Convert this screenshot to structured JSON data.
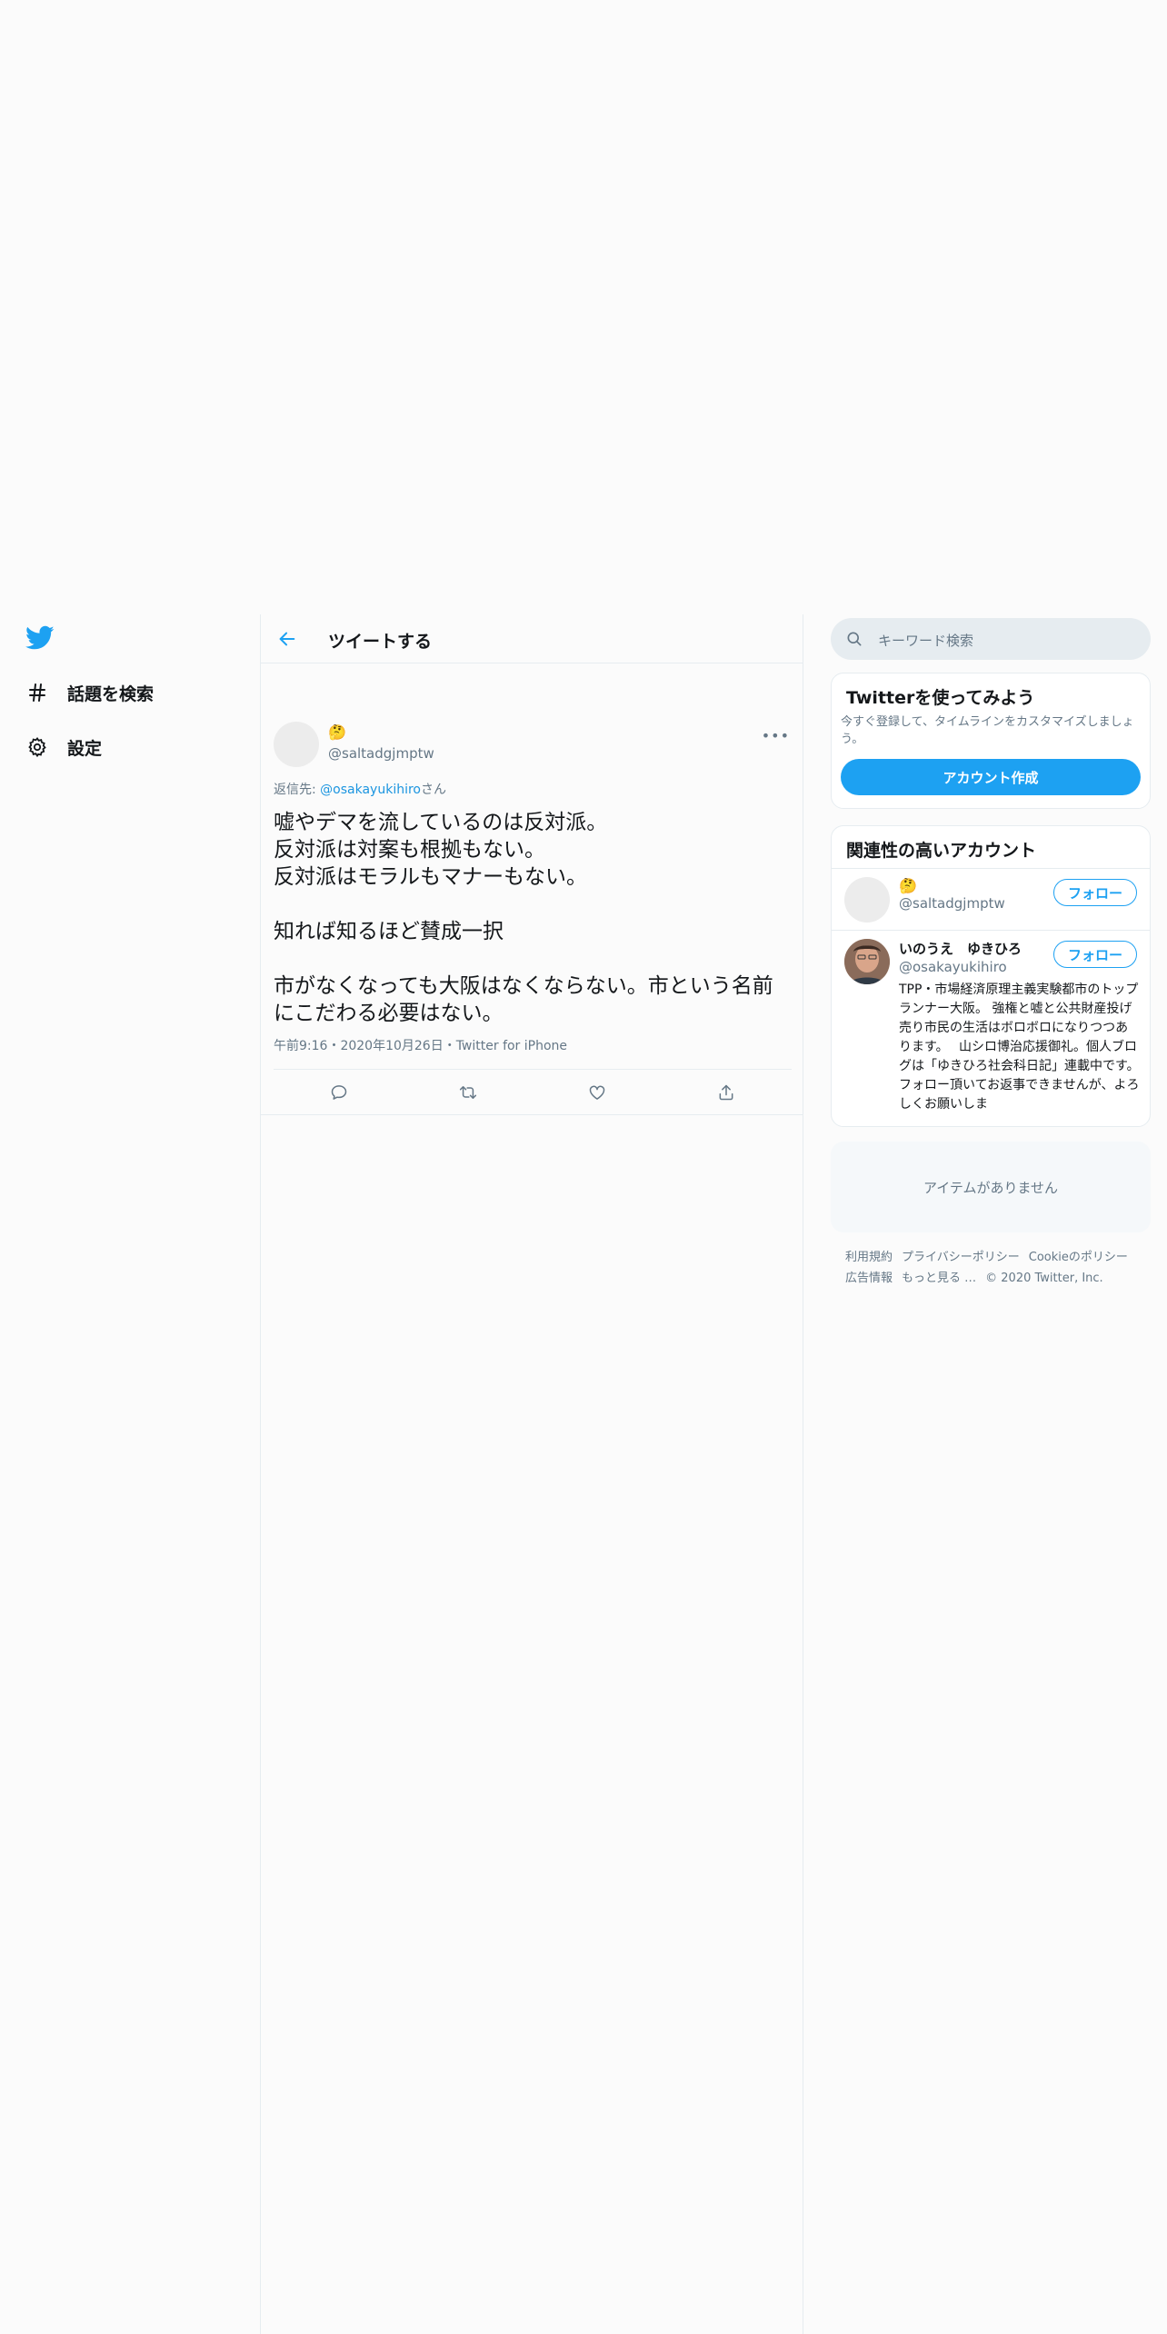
{
  "nav": {
    "explore_label": "話題を検索",
    "settings_label": "設定"
  },
  "header": {
    "title": "ツイートする"
  },
  "tweet": {
    "author_emoji": "🤔",
    "author_handle": "@saltadgjmptw",
    "reply_prefix": "返信先: ",
    "reply_link": "@osakayukihiro",
    "reply_suffix": "さん",
    "text": "嘘やデマを流しているのは反対派。\n反対派は対案も根拠もない。\n反対派はモラルもマナーもない。\n\n知れば知るほど賛成一択\n\n市がなくなっても大阪はなくならない。市という名前にこだわる必要はない。",
    "meta": "午前9:16・2020年10月26日・Twitter for iPhone",
    "more_glyph": "•••"
  },
  "search": {
    "placeholder": "キーワード検索"
  },
  "signup_card": {
    "title": "Twitterを使ってみよう",
    "subtitle": "今すぐ登録して、タイムラインをカスタマイズしましょう。",
    "button": "アカウント作成"
  },
  "related": {
    "title": "関連性の高いアカウント",
    "accounts": [
      {
        "name": "🤔",
        "handle": "@saltadgjmptw",
        "follow": "フォロー"
      },
      {
        "name": "いのうえ　ゆきひろ",
        "handle": "@osakayukihiro",
        "follow": "フォロー",
        "bio": "TPP・市場経済原理主義実験都市のトップランナー大阪。 強権と嘘と公共財産投げ売り市民の生活はボロボロになりつつあります。　 山シロ博治応援御礼。個人ブログは「ゆきひろ社会科日記」連載中です。 フォロー頂いてお返事できませんが、よろしくお願いしま"
      }
    ]
  },
  "empty_card": {
    "text": "アイテムがありません"
  },
  "footer": {
    "links": [
      "利用規約",
      "プライバシーポリシー",
      "Cookieのポリシー",
      "広告情報",
      "もっと見る …"
    ],
    "copyright": "© 2020 Twitter, Inc."
  },
  "colors": {
    "accent": "#1da1f2",
    "link": "#1b95e0",
    "secondary_text": "#657786",
    "border": "#e6ecf0"
  }
}
